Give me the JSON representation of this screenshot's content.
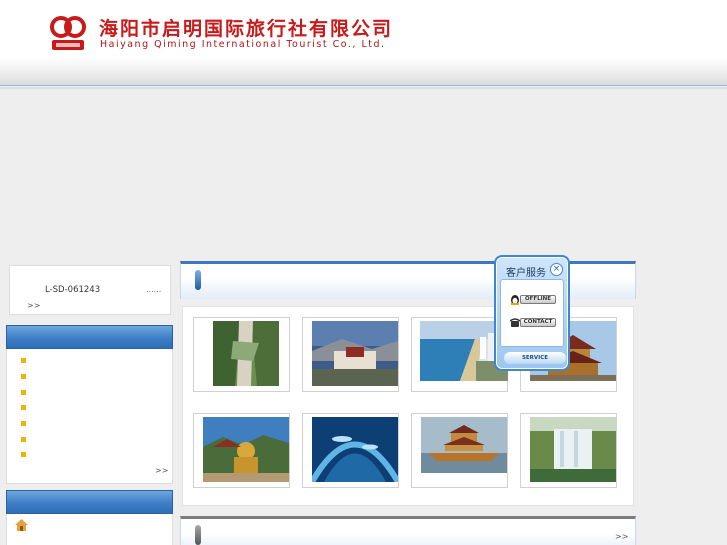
{
  "header": {
    "title_cn": "海阳市启明国际旅行社有限公司",
    "title_en": "Haiyang Qiming International Tourist Co., Ltd."
  },
  "product": {
    "code": "L-SD-061243",
    "dots": "......",
    "more": ">>"
  },
  "sidebar": {
    "list_more": ">>",
    "bullet_count": 7
  },
  "gallery": {
    "images": [
      "mountain-valley",
      "potala-palace",
      "coastal-city",
      "pagoda-temple",
      "buddha-statue",
      "underwater-tunnel",
      "dragon-boat",
      "waterfall"
    ]
  },
  "bottom": {
    "more": ">>"
  },
  "service": {
    "title": "客户服务",
    "close": "×",
    "offline_label": "OFFLINE",
    "contact_label": "CONTACT",
    "footer_label": "SERVICE"
  },
  "colors": {
    "brand_red": "#c71a1a",
    "accent_blue": "#3c78c0",
    "bullet": "#f0b400"
  }
}
